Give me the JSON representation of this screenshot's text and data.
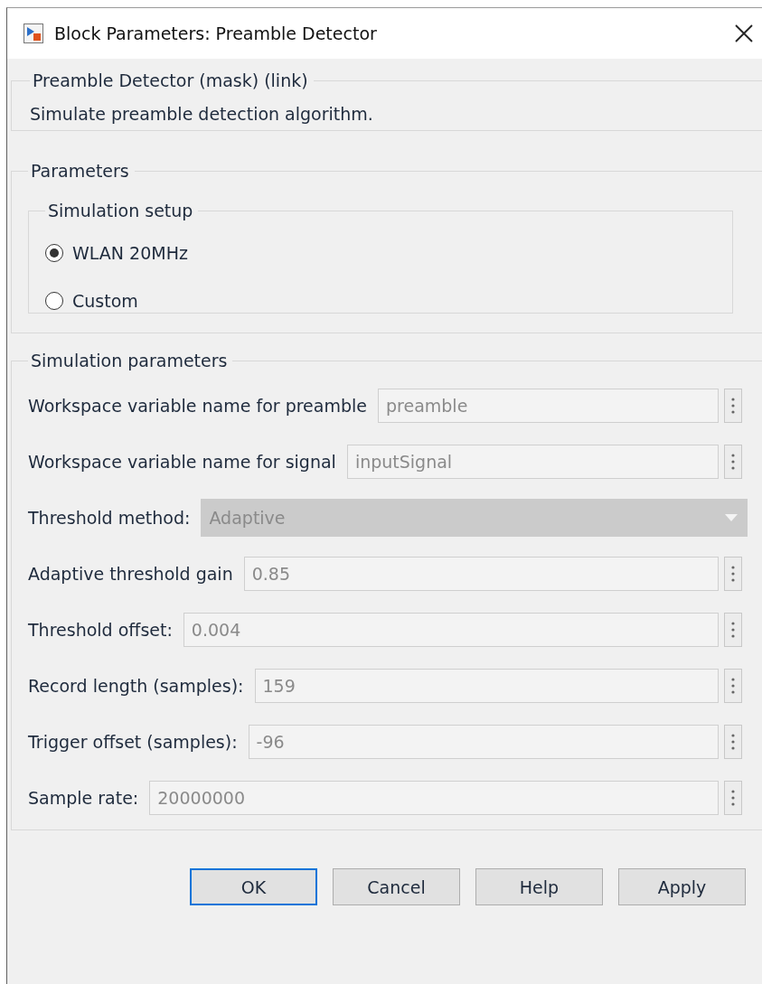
{
  "window": {
    "title": "Block Parameters: Preamble Detector"
  },
  "description_group": {
    "title": "Preamble Detector (mask) (link)",
    "text": "Simulate preamble detection algorithm."
  },
  "parameters_group": {
    "title": "Parameters",
    "setup": {
      "title": "Simulation setup",
      "options": [
        {
          "label": "WLAN 20MHz",
          "selected": true
        },
        {
          "label": "Custom",
          "selected": false
        }
      ]
    }
  },
  "simulation_parameters": {
    "title": "Simulation parameters",
    "fields": [
      {
        "kind": "text",
        "label": "Workspace variable name for preamble",
        "value": "preamble",
        "disabled": true
      },
      {
        "kind": "text",
        "label": "Workspace variable name for signal",
        "value": "inputSignal",
        "disabled": true
      },
      {
        "kind": "dropdown",
        "label": "Threshold method:",
        "value": "Adaptive",
        "disabled": true
      },
      {
        "kind": "text",
        "label": "Adaptive threshold gain",
        "value": "0.85",
        "disabled": true
      },
      {
        "kind": "text",
        "label": "Threshold offset:",
        "value": "0.004",
        "disabled": true
      },
      {
        "kind": "text",
        "label": "Record length (samples):",
        "value": "159",
        "disabled": true
      },
      {
        "kind": "text",
        "label": "Trigger offset (samples):",
        "value": "-96",
        "disabled": true
      },
      {
        "kind": "text",
        "label": "Sample rate:",
        "value": "20000000",
        "disabled": true
      }
    ]
  },
  "buttons": [
    {
      "label": "OK",
      "default": true
    },
    {
      "label": "Cancel",
      "default": false
    },
    {
      "label": "Help",
      "default": false
    },
    {
      "label": "Apply",
      "default": false
    }
  ]
}
